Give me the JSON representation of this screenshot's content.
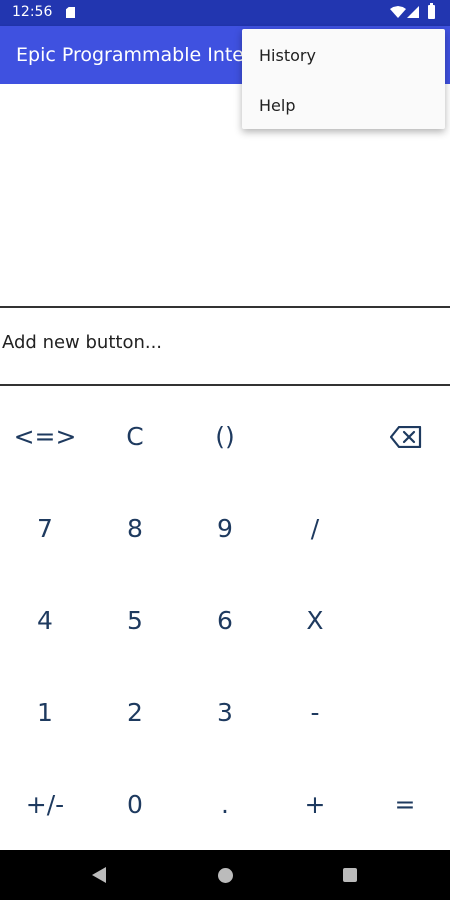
{
  "status_bar": {
    "time": "12:56"
  },
  "app_bar": {
    "title": "Epic Programmable Inte"
  },
  "add_bar": {
    "label": "Add new button..."
  },
  "keypad": {
    "rows": [
      [
        "<=>",
        "C",
        "()",
        "",
        "backspace"
      ],
      [
        "7",
        "8",
        "9",
        "/",
        ""
      ],
      [
        "4",
        "5",
        "6",
        "X",
        ""
      ],
      [
        "1",
        "2",
        "3",
        "-",
        ""
      ],
      [
        "+/-",
        "0",
        ".",
        "+",
        "="
      ]
    ]
  },
  "menu": {
    "items": [
      "History",
      "Help"
    ]
  }
}
